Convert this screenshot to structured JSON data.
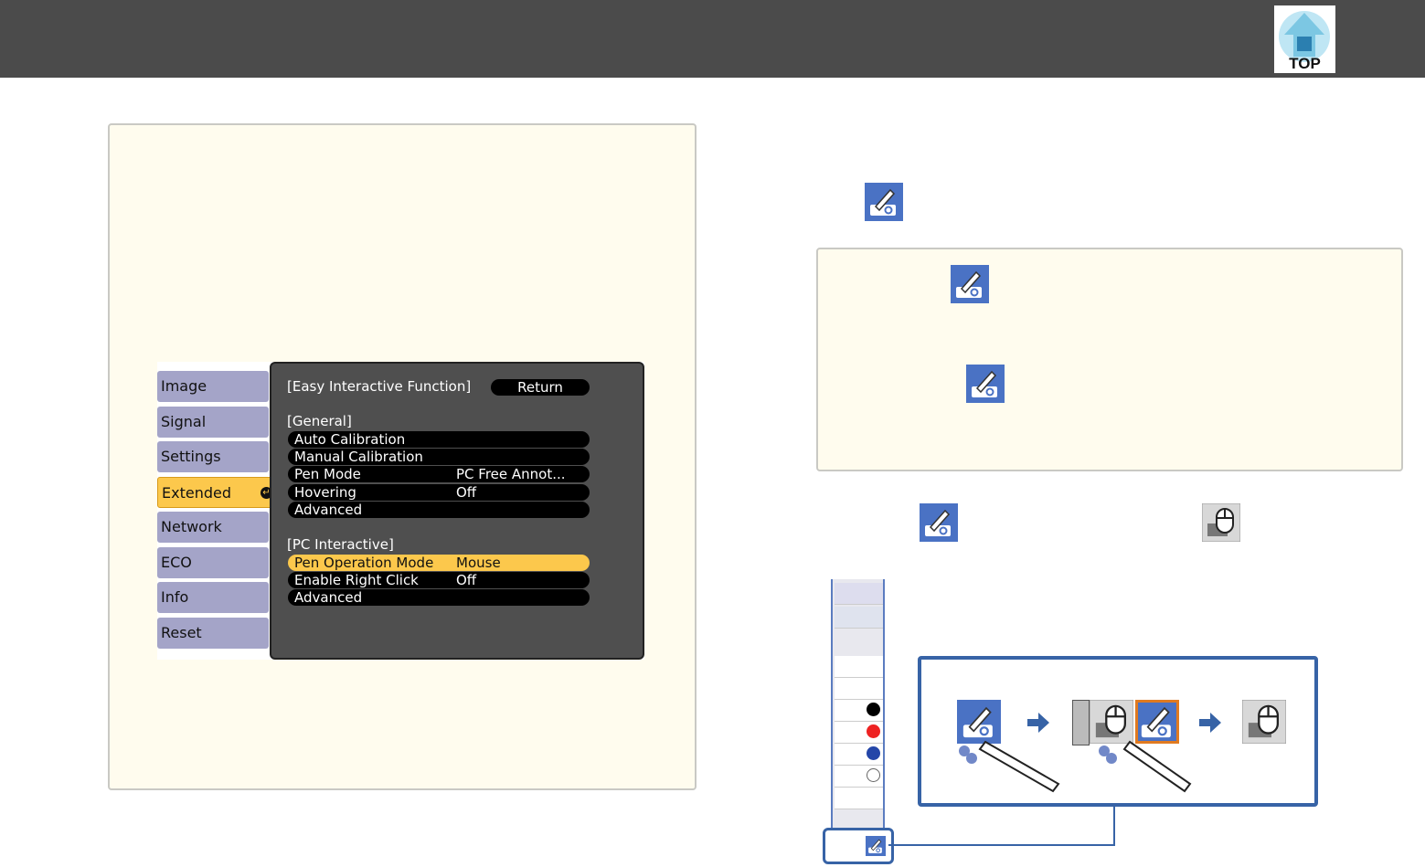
{
  "header": {
    "top_label": "TOP",
    "bg": "#4b4b4b"
  },
  "menu": {
    "sidebar": [
      {
        "label": "Image"
      },
      {
        "label": "Signal"
      },
      {
        "label": "Settings"
      },
      {
        "label": "Extended",
        "selected": true
      },
      {
        "label": "Network"
      },
      {
        "label": "ECO"
      },
      {
        "label": "Info"
      },
      {
        "label": "Reset"
      }
    ],
    "title": "[Easy Interactive Function]",
    "return_label": "Return",
    "general_heading": "[General]",
    "general": [
      {
        "label": "Auto Calibration",
        "value": ""
      },
      {
        "label": "Manual Calibration",
        "value": ""
      },
      {
        "label": "Pen Mode",
        "value": "PC Free Annot..."
      },
      {
        "label": "Hovering",
        "value": "Off"
      },
      {
        "label": "Advanced",
        "value": ""
      }
    ],
    "pc_heading": "[PC Interactive]",
    "pc": [
      {
        "label": "Pen Operation Mode",
        "value": "Mouse",
        "selected": true
      },
      {
        "label": "Enable Right Click",
        "value": "Off"
      },
      {
        "label": "Advanced",
        "value": ""
      }
    ]
  },
  "icons": {
    "pen_mode": "pen-projector-icon",
    "mouse_mode": "mouse-icon",
    "arrow": "right-arrow-icon"
  },
  "colors": {
    "accent": "#3763a6",
    "highlight": "#fcc84c",
    "icon_blue": "#4a72c4"
  }
}
